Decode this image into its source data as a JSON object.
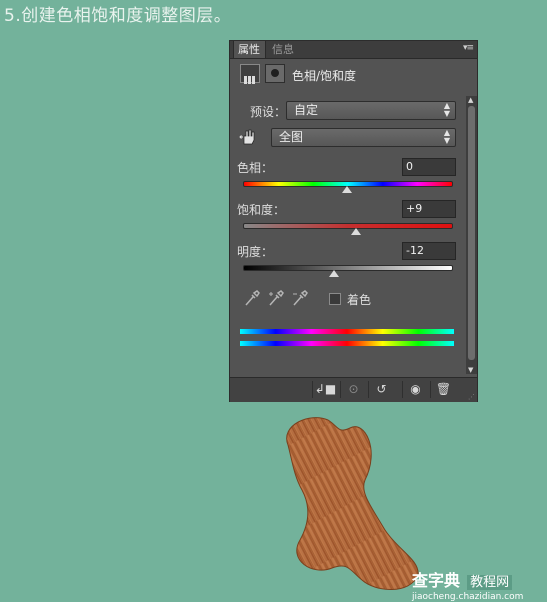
{
  "step_title": "5.创建色相饱和度调整图层。",
  "panel": {
    "tabs": [
      {
        "label": "属性",
        "active": true
      },
      {
        "label": "信息",
        "active": false
      }
    ],
    "menu_icon": "panel-menu-icon",
    "adjustment_title": "色相/饱和度",
    "preset": {
      "label": "预设：",
      "value": "自定"
    },
    "channel": {
      "value": "全图"
    },
    "hue": {
      "label": "色相：",
      "value": "0",
      "thumb_fraction": 0.5
    },
    "saturation": {
      "label": "饱和度：",
      "value": "+9",
      "thumb_fraction": 0.545
    },
    "lightness": {
      "label": "明度：",
      "value": "-12",
      "thumb_fraction": 0.44
    },
    "colorize": {
      "label": "着色",
      "checked": false
    },
    "colors": {
      "bg": "#535353",
      "tab_bar": "#3d3d3d",
      "page_bg": "#73b29b",
      "wood": "#b9703f"
    }
  },
  "watermark": {
    "line1": "查字典",
    "line2": "教程网",
    "line3": "jiaocheng.chazidian.com"
  }
}
